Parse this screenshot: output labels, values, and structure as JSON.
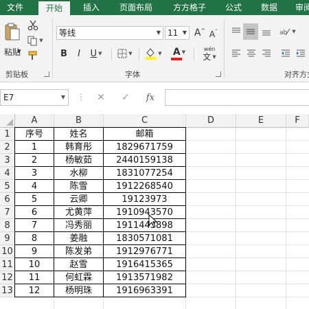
{
  "menu": {
    "tabs": [
      {
        "label": "文件",
        "active": false
      },
      {
        "label": "开始",
        "active": true
      },
      {
        "label": "插入",
        "active": false
      },
      {
        "label": "页面布局",
        "active": false
      },
      {
        "label": "方方格子",
        "active": false
      },
      {
        "label": "公式",
        "active": false
      },
      {
        "label": "数据",
        "active": false
      },
      {
        "label": "审阅",
        "active": false
      }
    ]
  },
  "ribbon": {
    "paste_label": "粘贴",
    "clipboard_label": "剪贴板",
    "font_name": "等线",
    "font_size": "11",
    "font_group_label": "字体",
    "align_group_label": "对齐方式",
    "bold": "B",
    "italic": "I",
    "underline": "U",
    "grow_font": "A",
    "shrink_font": "A",
    "font_color_glyph": "A",
    "phonetic_glyph": "wén",
    "phonetic_char": "文",
    "accent_fill": "#ffff00",
    "accent_font": "#e02020"
  },
  "formula_bar": {
    "name_box": "E7",
    "cancel_glyph": "✕",
    "enter_glyph": "✓",
    "fx_glyph": "fx",
    "formula": ""
  },
  "grid": {
    "columns": [
      "A",
      "B",
      "C",
      "D",
      "E",
      "F"
    ],
    "rows": [
      "1",
      "2",
      "3",
      "4",
      "5",
      "6",
      "7",
      "8",
      "9",
      "10",
      "11",
      "12",
      "13"
    ],
    "header": [
      "序号",
      "姓名",
      "邮箱"
    ],
    "data": [
      [
        "1",
        "韩育彤",
        "1829671759"
      ],
      [
        "2",
        "杨敏茹",
        "2440159138"
      ],
      [
        "3",
        "水柳",
        "1831077254"
      ],
      [
        "4",
        "陈雪",
        "1912268540"
      ],
      [
        "5",
        "云卿",
        "19123973"
      ],
      [
        "6",
        "尤黄萍",
        "1910943570"
      ],
      [
        "7",
        "冯秀丽",
        "1911443898"
      ],
      [
        "8",
        "姜融",
        "1830571081"
      ],
      [
        "9",
        "陈发弟",
        "1912976771"
      ],
      [
        "10",
        "赵雪",
        "1916415365"
      ],
      [
        "11",
        "何虹霖",
        "1913571982"
      ],
      [
        "12",
        "杨明珠",
        "1916963391"
      ]
    ]
  }
}
